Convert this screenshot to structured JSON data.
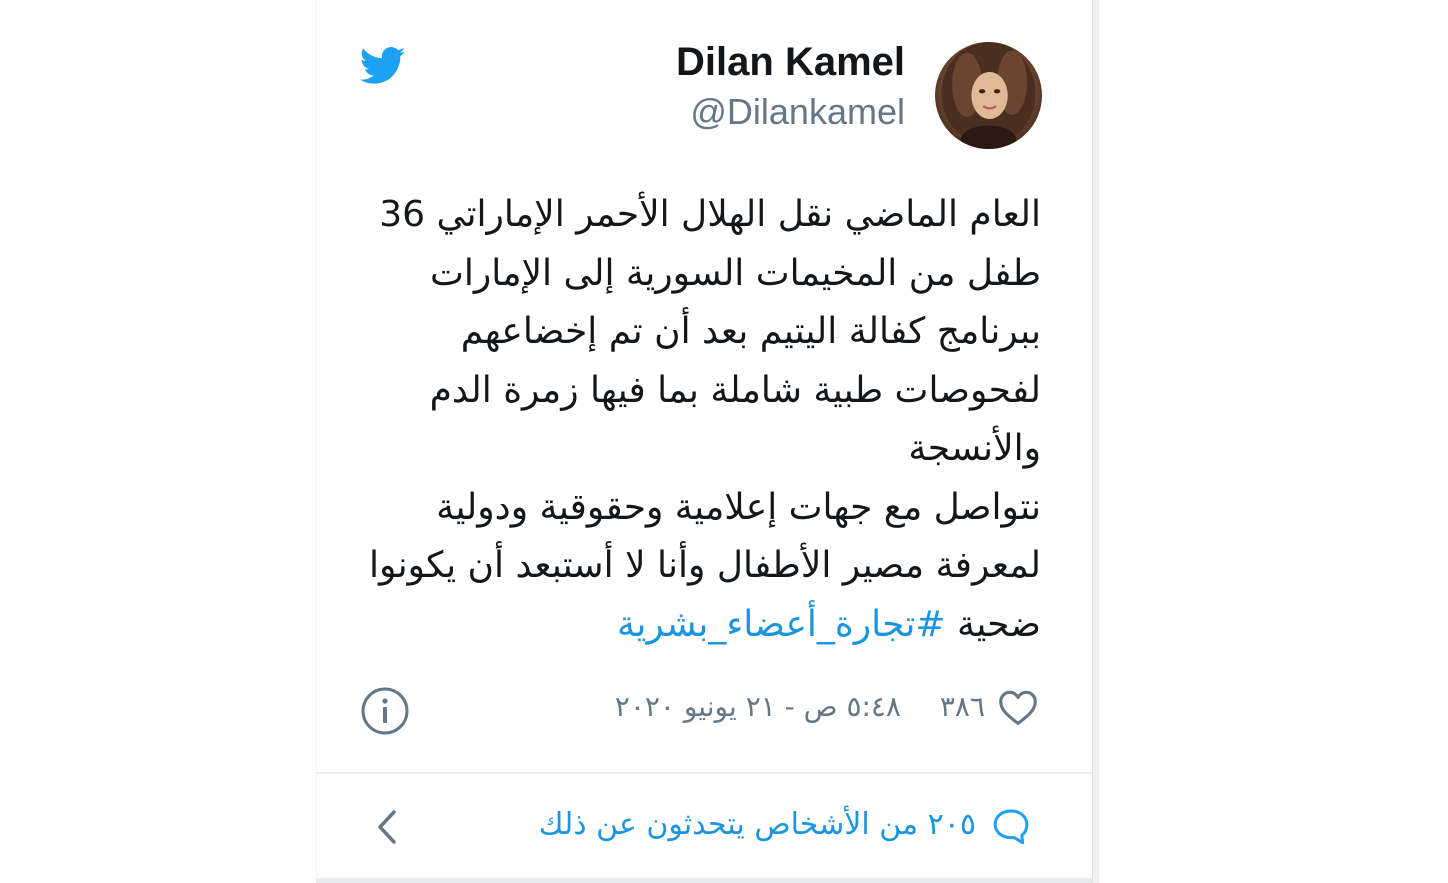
{
  "tweet": {
    "author_name": "Dilan Kamel",
    "author_handle": "@Dilankamel",
    "lines": [
      "العام الماضي نقل الهلال الأحمر الإماراتي 36",
      "طفل من المخيمات السورية إلى الإمارات",
      "ببرنامج كفالة اليتيم بعد أن تم إخضاعهم",
      "لفحوصات طبية شاملة بما فيها زمرة الدم",
      "والأنسجة",
      "نتواصل مع جهات إعلامية وحقوقية ودولية",
      "لمعرفة مصير الأطفال وأنا لا أستبعد أن يكونوا"
    ],
    "last_line_prefix": "ضحية ",
    "hashtag": "#تجارة_أعضاء_بشرية",
    "likes": "٣٨٦",
    "timestamp": "٥:٤٨ ص - ٢١ يونيو ٢٠٢٠",
    "conversation": "٢٠٥ من الأشخاص يتحدثون عن ذلك"
  },
  "icons": {
    "bird": "twitter-bird-icon",
    "info": "info-icon",
    "heart": "heart-icon",
    "bubble": "speech-bubble-icon",
    "chevron": "chevron-left-icon"
  },
  "colors": {
    "brand_blue": "#1da1f2",
    "link_blue": "#1b95e0",
    "text": "#14171a",
    "muted": "#657786"
  }
}
